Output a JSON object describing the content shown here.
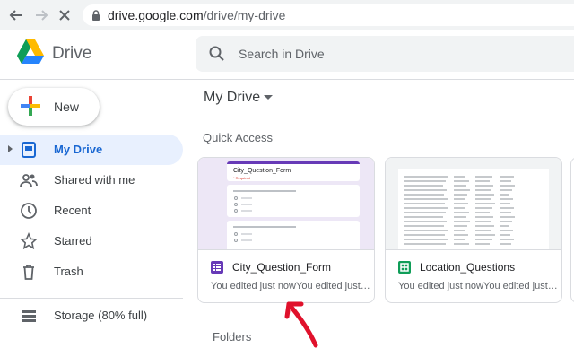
{
  "browser": {
    "url_host": "drive.google.com",
    "url_path": "/drive/my-drive"
  },
  "app": {
    "brand": "Drive",
    "search_placeholder": "Search in Drive"
  },
  "sidebar": {
    "new_label": "New",
    "items": [
      {
        "label": "My Drive",
        "icon": "my-drive-icon",
        "active": true
      },
      {
        "label": "Shared with me",
        "icon": "people-icon"
      },
      {
        "label": "Recent",
        "icon": "clock-icon"
      },
      {
        "label": "Starred",
        "icon": "star-icon"
      },
      {
        "label": "Trash",
        "icon": "trash-icon"
      }
    ],
    "storage_label": "Storage (80% full)"
  },
  "main": {
    "title": "My Drive",
    "quick_access_label": "Quick Access",
    "folders_label": "Folders",
    "cards": [
      {
        "name": "City_Question_Form",
        "subtitle": "You edited just nowYou edited just now",
        "type": "form",
        "preview_title": "City_Question_Form",
        "preview_required": "* Required"
      },
      {
        "name": "Location_Questions",
        "subtitle": "You edited just nowYou edited just now",
        "type": "sheet"
      }
    ]
  },
  "colors": {
    "accent": "#1967d2",
    "form": "#673ab7",
    "sheet": "#0f9d58",
    "annotation": "#e0112b"
  }
}
